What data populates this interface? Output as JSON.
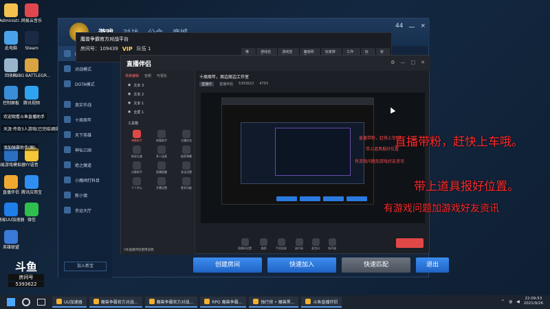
{
  "desktop": {
    "icons": [
      {
        "label": "Administr...",
        "color": "#f2c14e"
      },
      {
        "label": "网易云音乐",
        "color": "#e0464e"
      },
      {
        "label": "此电脑",
        "color": "#4aa3e8"
      },
      {
        "label": "Steam",
        "color": "#1b2a44"
      },
      {
        "label": "回收站",
        "color": "#9ab4cc"
      },
      {
        "label": "PUBG BATTLEGR...",
        "color": "#d9a441"
      },
      {
        "label": "控制面板",
        "color": "#3a8ed8"
      },
      {
        "label": "腾讯视频",
        "color": "#2fa3f0"
      },
      {
        "label": "网易游戏模拟器",
        "color": "#2b6fc2"
      },
      {
        "label": "YY语音",
        "color": "#f5c636"
      },
      {
        "label": "直播伴侣",
        "color": "#f0a830"
      },
      {
        "label": "腾讯应用宝",
        "color": "#2f8ff0"
      },
      {
        "label": "网易UU加速器",
        "color": "#1f7ee8"
      },
      {
        "label": "微信",
        "color": "#2fbf4f"
      },
      {
        "label": "英雄联盟",
        "color": "#3a7ad8"
      }
    ],
    "notes": [
      "欢迎观看斗鱼直播助手",
      "天涯·传奇3人游戏(已完结)跑路王",
      "添加弹幕助手(图)"
    ]
  },
  "game": {
    "tabs": [
      "游戏",
      "对战",
      "公会",
      "商城"
    ],
    "controls": [
      "44",
      "一",
      "×"
    ],
    "sidebar": [
      "RPG游戏大厅",
      "对战模式",
      "DOTA模式",
      "真实作战",
      "十周周年",
      "天下英雄",
      "神仙三国",
      "绝之魔道",
      "小魔阀打科目",
      "新小镇",
      "幸运大厅"
    ],
    "sidebar_bottom": "加入新宝",
    "buttons": [
      "创建房间",
      "快速加入",
      "快速匹配",
      "退出"
    ]
  },
  "room": {
    "logo": "魔兽争霸官方对战平台",
    "room_no": "房间号：109439",
    "vip": "VIP",
    "team": "队伍 1",
    "tabs": [
      "等级",
      "游戏名称",
      "游戏宣传",
      "魔兽称号",
      "玩家排名",
      "工作室",
      "玩法",
      "状态"
    ]
  },
  "streamer": {
    "logo": "直播伴侣",
    "title": "十周周年，周边周边工作室",
    "sub_meta": [
      "直播中",
      "直播伴侣",
      "5393622",
      "4793"
    ],
    "left_tabs": [
      "场景编辑",
      "音频",
      "可视化"
    ],
    "scenes": [
      "文本 3",
      "文本 2",
      "文本 1",
      "全屏 1"
    ],
    "tools_title": "工具箱",
    "tools": [
      "弹幕助手",
      "房管助手",
      "主播任务",
      "粉丝礼盒",
      "多人连麦",
      "抽奖弹幕",
      "点歌助手",
      "直播提醒",
      "发送设置",
      "个人中心",
      "开播设置",
      "更多功能"
    ],
    "bottom_note": "5条直播伴侣使用说明",
    "footer": [
      "直播间设置",
      "美颜",
      "手机投屏",
      "画中画",
      "麦克风",
      "扬声器"
    ]
  },
  "overlay": {
    "line1": "直播带粉，赶快上车哦。",
    "line2": "带上道具报好位置。",
    "line3": "有游戏问题加游戏好友资讯",
    "small1": "直播带粉，赶快上车哦",
    "small2": "带上道具报好位置",
    "small3": "有游戏问题加游戏好友资讯"
  },
  "douyu": {
    "logo": "斗鱼",
    "room_label": "房间号",
    "room_number": "5393622"
  },
  "taskbar": {
    "items": [
      "UU加速器",
      "魔兽争霸官方对战...",
      "魔兽争霸官方对战...",
      "RPG 魔兽争霸...",
      "独行侠 • 魔兽黑...",
      "斗鱼直播伴侣"
    ],
    "time": "22:09:53",
    "date": "2021/9/26"
  }
}
